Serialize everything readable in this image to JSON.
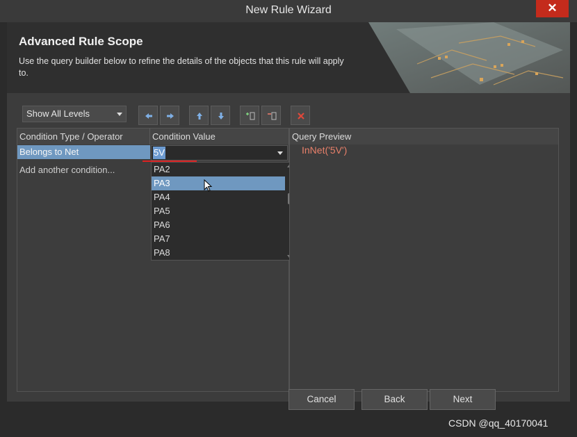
{
  "window": {
    "title": "New Rule Wizard",
    "close_label": "✕"
  },
  "header": {
    "title": "Advanced Rule Scope",
    "description": "Use the query builder below to refine the details of the objects that this rule will apply to."
  },
  "toolbar": {
    "levels_value": "Show All Levels",
    "buttons": [
      "arrow-left-icon",
      "arrow-right-icon",
      "arrow-up-icon",
      "arrow-down-icon",
      "add-icon",
      "remove-icon",
      "delete-icon"
    ]
  },
  "table": {
    "headers": [
      "Condition Type / Operator",
      "Condition Value",
      "Query Preview"
    ],
    "rows": [
      {
        "type": "Belongs to Net",
        "value": "5V"
      },
      {
        "type": "Add another condition...",
        "value": ""
      }
    ],
    "query_preview": "InNet('5V')"
  },
  "dropdown": {
    "options": [
      "PA2",
      "PA3",
      "PA4",
      "PA5",
      "PA6",
      "PA7",
      "PA8"
    ],
    "highlighted": "PA3"
  },
  "footer": {
    "cancel_label": "Cancel",
    "back_label": "Back",
    "next_label": "Next"
  },
  "watermark": "CSDN @qq_40170041",
  "colors": {
    "accent": "#6f98c0",
    "close": "#c42b1c",
    "query": "#e8806a",
    "underline": "#dd2222"
  }
}
